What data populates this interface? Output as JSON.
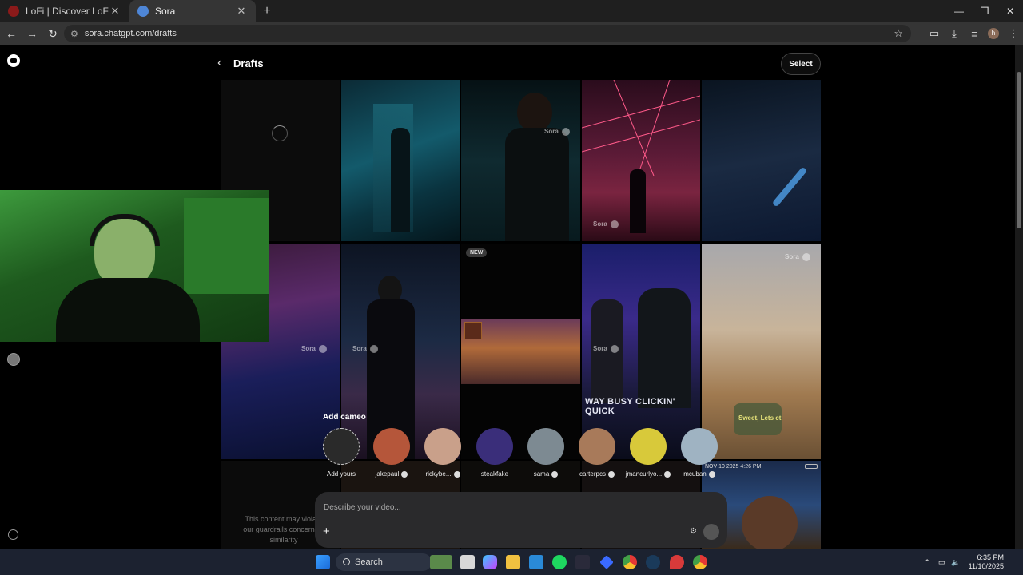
{
  "browser": {
    "tabs": [
      {
        "title": "LoFi | Discover LoFi Music Now",
        "active": false,
        "favicon_color": "#8b1a1a"
      },
      {
        "title": "Sora",
        "active": true,
        "favicon_color": "#4e86d6"
      }
    ],
    "url": "sora.chatgpt.com/drafts"
  },
  "header": {
    "title": "Drafts",
    "select_label": "Select"
  },
  "tiles": {
    "new_badge": "NEW",
    "watermark": "Sora",
    "caption_concert": "WAY BUSY CLICKIN' QUICK",
    "caption_game": "Sweet, Lets ct",
    "caption_timestamp": "NOV 10 2025   4:26 PM",
    "guardrail_text": "This content may violate our guardrails concerning similarity"
  },
  "cameo": {
    "title": "Add cameo",
    "items": [
      {
        "name": "Add yours",
        "verified": false,
        "color": "#3a3a3a"
      },
      {
        "name": "jakepaul",
        "verified": true,
        "color": "#b5563a"
      },
      {
        "name": "rickybe...",
        "verified": true,
        "color": "#c9a08a"
      },
      {
        "name": "steakfake",
        "verified": false,
        "color": "#3a2e7a"
      },
      {
        "name": "sama",
        "verified": true,
        "color": "#7d8a92"
      },
      {
        "name": "carterpcs",
        "verified": true,
        "color": "#a87a5a"
      },
      {
        "name": "jmancurlyo...",
        "verified": true,
        "color": "#d8c93a"
      },
      {
        "name": "mcuban",
        "verified": true,
        "color": "#9fb3c2"
      }
    ]
  },
  "prompt": {
    "placeholder": "Describe your video..."
  },
  "taskbar": {
    "search_label": "Search",
    "time": "6:35 PM",
    "date": "11/10/2025"
  }
}
